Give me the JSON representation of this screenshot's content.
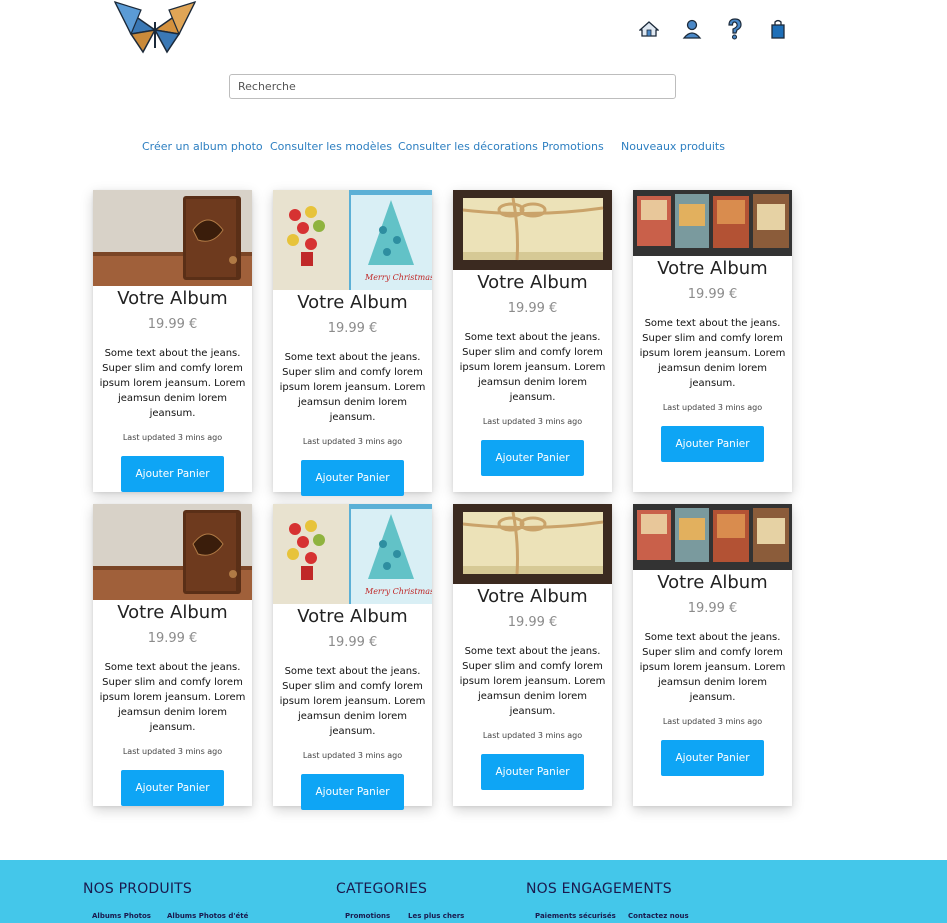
{
  "header": {
    "logo": "butterfly-logo",
    "icons": [
      "home-icon",
      "user-icon",
      "help-icon",
      "shopping-bag-icon"
    ]
  },
  "search": {
    "placeholder": "Recherche"
  },
  "nav": {
    "items": [
      "Créer un album photo",
      "Consulter les modèles",
      "Consulter les décorations",
      "Promotions",
      "Nouveaux produits"
    ]
  },
  "products": [
    {
      "title": "Votre Album",
      "price": "19.99 €",
      "description": "Some text about the jeans. Super slim and comfy lorem ipsum lorem jeansum. Lorem jeamsun denim lorem jeansum.",
      "updated": "Last updated 3 mins ago",
      "button": "Ajouter Panier",
      "image": "wooden-album-image"
    },
    {
      "title": "Votre Album",
      "price": "19.99 €",
      "description": "Some text about the jeans. Super slim and comfy lorem ipsum lorem jeansum. Lorem jeamsun denim lorem jeansum.",
      "updated": "Last updated 3 mins ago",
      "button": "Ajouter Panier",
      "image": "christmas-cards-image"
    },
    {
      "title": "Votre Album",
      "price": "19.99 €",
      "description": "Some text about the jeans. Super slim and comfy lorem ipsum lorem jeansum. Lorem jeamsun denim lorem jeansum.",
      "updated": "Last updated 3 mins ago",
      "button": "Ajouter Panier",
      "image": "twine-box-image"
    },
    {
      "title": "Votre Album",
      "price": "19.99 €",
      "description": "Some text about the jeans. Super slim and comfy lorem ipsum lorem jeansum. Lorem jeamsun denim lorem jeansum.",
      "updated": "Last updated 3 mins ago",
      "button": "Ajouter Panier",
      "image": "scrapbook-pages-image"
    },
    {
      "title": "Votre Album",
      "price": "19.99 €",
      "description": "Some text about the jeans. Super slim and comfy lorem ipsum lorem jeansum. Lorem jeamsun denim lorem jeansum.",
      "updated": "Last updated 3 mins ago",
      "button": "Ajouter Panier",
      "image": "wooden-album-image"
    },
    {
      "title": "Votre Album",
      "price": "19.99 €",
      "description": "Some text about the jeans. Super slim and comfy lorem ipsum lorem jeansum. Lorem jeamsun denim lorem jeansum.",
      "updated": "Last updated 3 mins ago",
      "button": "Ajouter Panier",
      "image": "christmas-cards-image"
    },
    {
      "title": "Votre Album",
      "price": "19.99 €",
      "description": "Some text about the jeans. Super slim and comfy lorem ipsum lorem jeansum. Lorem jeamsun denim lorem jeansum.",
      "updated": "Last updated 3 mins ago",
      "button": "Ajouter Panier",
      "image": "twine-box-image"
    },
    {
      "title": "Votre Album",
      "price": "19.99 €",
      "description": "Some text about the jeans. Super slim and comfy lorem ipsum lorem jeansum. Lorem jeamsun denim lorem jeansum.",
      "updated": "Last updated 3 mins ago",
      "button": "Ajouter Panier",
      "image": "scrapbook-pages-image"
    }
  ],
  "footer": {
    "columns": [
      {
        "heading": "NOS PRODUITS",
        "links": [
          "Albums Photos",
          "Albums Photos d'été"
        ]
      },
      {
        "heading": "CATEGORIES",
        "links": [
          "Promotions",
          "Les plus chers"
        ]
      },
      {
        "heading": "NOS ENGAGEMENTS",
        "links": [
          "Paiements sécurisés",
          "Contactez nous"
        ]
      }
    ],
    "color": "#44c7ea"
  },
  "colors": {
    "accent": "#0ea5f5",
    "link": "#2d7fc1"
  }
}
